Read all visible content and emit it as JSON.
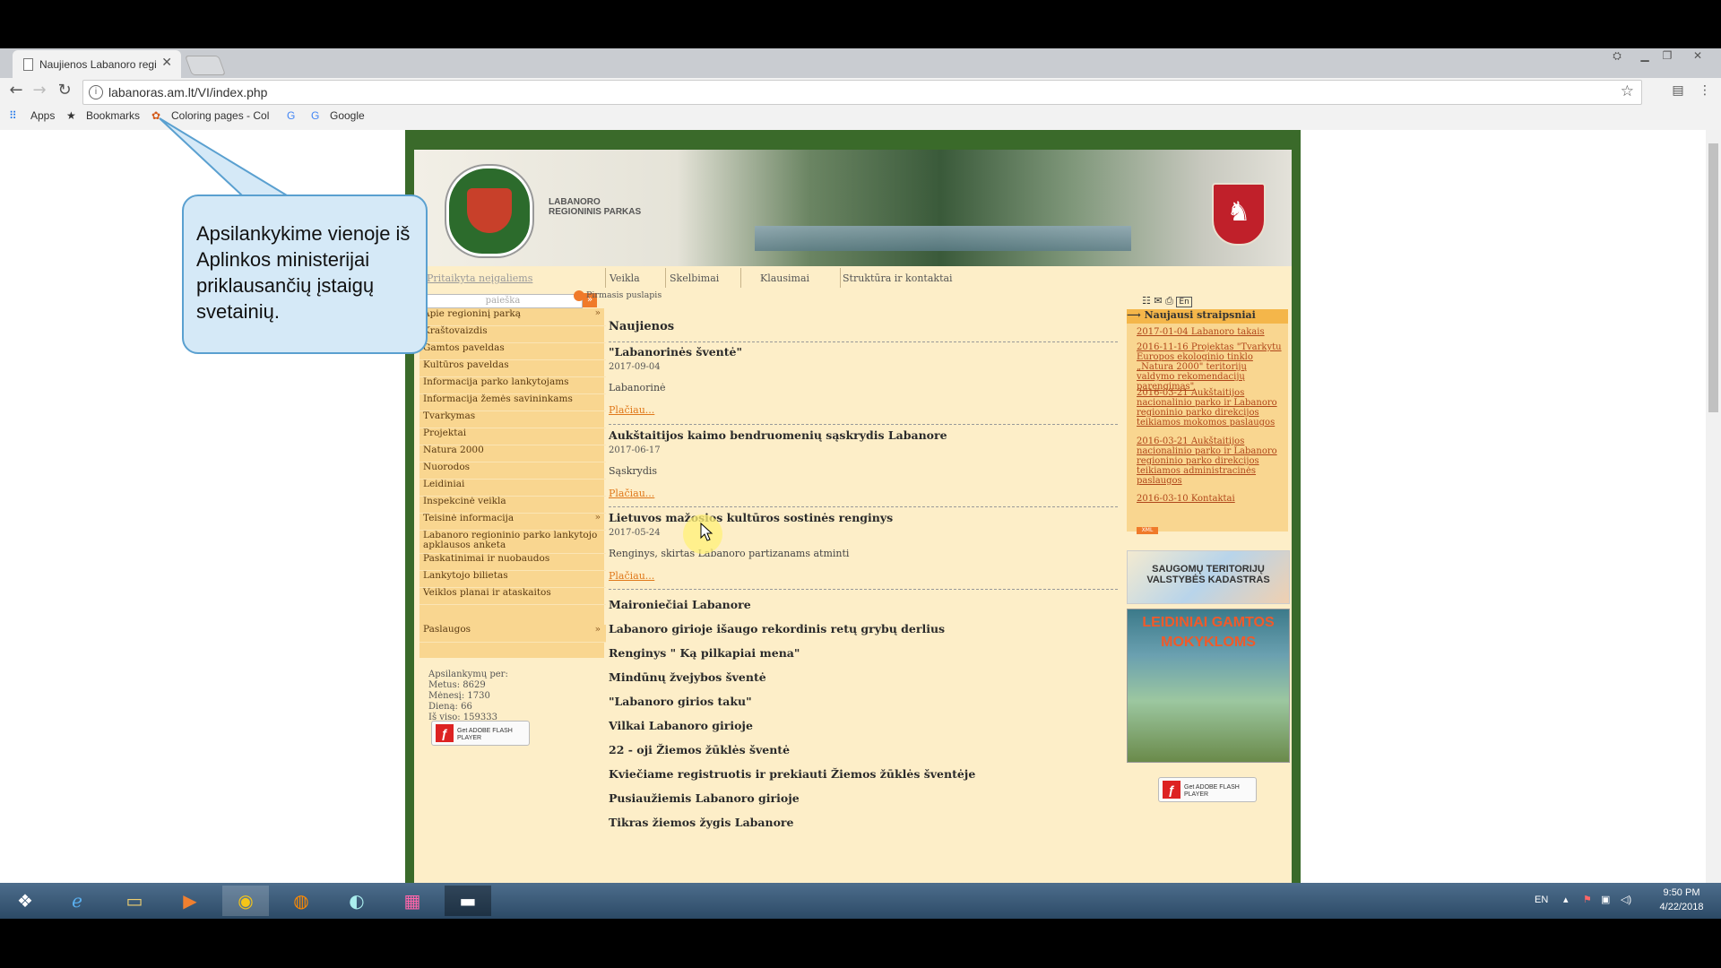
{
  "browser": {
    "tab_title": "Naujienos Labanoro regi",
    "url": "labanoras.am.lt/VI/index.php",
    "bookmarks": [
      {
        "label": "Apps"
      },
      {
        "label": "Bookmarks"
      },
      {
        "label": "Coloring pages - Col"
      },
      {
        "label": "Google"
      }
    ]
  },
  "site": {
    "logo_text_line1": "LABANORO",
    "logo_text_line2": "REGIONINIS PARKAS",
    "accessible_link": "Pritaikyta neįgaliems",
    "topnav": [
      "Veikla",
      "Skelbimai",
      "Klausimai",
      "Struktūra ir kontaktai"
    ],
    "search_placeholder": "paieška",
    "left_menu": [
      {
        "label": "Apie regioninį parką",
        "arrow": true
      },
      {
        "label": "Kraštovaizdis"
      },
      {
        "label": "Gamtos paveldas"
      },
      {
        "label": "Kultūros paveldas"
      },
      {
        "label": "Informacija parko lankytojams"
      },
      {
        "label": "Informacija žemės savininkams"
      },
      {
        "label": "Tvarkymas"
      },
      {
        "label": "Projektai"
      },
      {
        "label": "Natura 2000"
      },
      {
        "label": "Nuorodos"
      },
      {
        "label": "Leidiniai"
      },
      {
        "label": "Inspekcinė veikla"
      },
      {
        "label": "Teisinė informacija",
        "arrow": true
      },
      {
        "label": "Labanoro regioninio parko lankytojo apklausos anketa"
      },
      {
        "label": "Paskatinimai ir nuobaudos"
      },
      {
        "label": "Lankytojo bilietas"
      },
      {
        "label": "Veiklos planai ir ataskaitos"
      }
    ],
    "services_label": "Paslaugos",
    "stats": {
      "heading": "Apsilankymų per:",
      "year": "Metus: 8629",
      "month": "Mėnesį: 1730",
      "day": "Dieną: 66",
      "total": "Iš viso: 159333"
    },
    "flash_label": "Get ADOBE FLASH PLAYER",
    "breadcrumb": "Pirmasis puslapis",
    "main_title": "Naujienos",
    "news": [
      {
        "title": "\"Labanorinės šventė\"",
        "date": "2017-09-04",
        "text": "Labanorinė",
        "more": "Plačiau..."
      },
      {
        "title": "Aukštaitijos kaimo bendruomenių sąskrydis Labanore",
        "date": "2017-06-17",
        "text": "Sąskrydis",
        "more": "Plačiau..."
      },
      {
        "title": "Lietuvos mažosios kultūros sostinės renginys",
        "date": "2017-05-24",
        "text": "Renginys, skirtas Labanoro partizanams atminti",
        "more": "Plačiau..."
      }
    ],
    "older_news": [
      "Maironiečiai Labanore",
      "Labanoro girioje išaugo rekordinis retų grybų derlius",
      "Renginys \" Ką pilkapiai mena\"",
      "Mindūnų žvejybos šventė",
      "\"Labanoro girios taku\"",
      "Vilkai Labanoro girioje",
      "22 - oji Žiemos žūklės šventė",
      "Kviečiame registruotis ir prekiauti Žiemos žūklės šventėje",
      "Pusiaužiemis Labanoro girioje",
      "Tikras žiemos žygis Labanore"
    ],
    "right": {
      "lang": "En",
      "heading": "Naujausi straipsniai",
      "articles": [
        "2017-01-04 Labanoro takais",
        "2016-11-16 Projektas \"Tvarkytu Europos ekologinio tinklo „Natura 2000\" teritorijų valdymo rekomendacijų parengimas\"",
        "2016-03-21 Aukštaitijos nacionalinio parko ir Labanoro regioninio parko direkcijos teikiamos mokomos paslaugos",
        "2016-03-21 Aukštaitijos nacionalinio parko ir Labanoro regioninio parko direkcijos teikiamos administracinės paslaugos",
        "2016-03-10 Kontaktai"
      ],
      "rss": "XML",
      "ad1_line1": "SAUGOMŲ TERITORIJŲ",
      "ad1_line2": "VALSTYBĖS KADASTRAS",
      "ad2_text": "LEIDINIAI GAMTOS MOKYKLOMS"
    }
  },
  "callout_text": "Apsilankykime vienoje iš Aplinkos ministerijai priklausančių įstaigų svetainių.",
  "taskbar": {
    "lang": "EN",
    "time": "9:50 PM",
    "date": "4/22/2018"
  }
}
